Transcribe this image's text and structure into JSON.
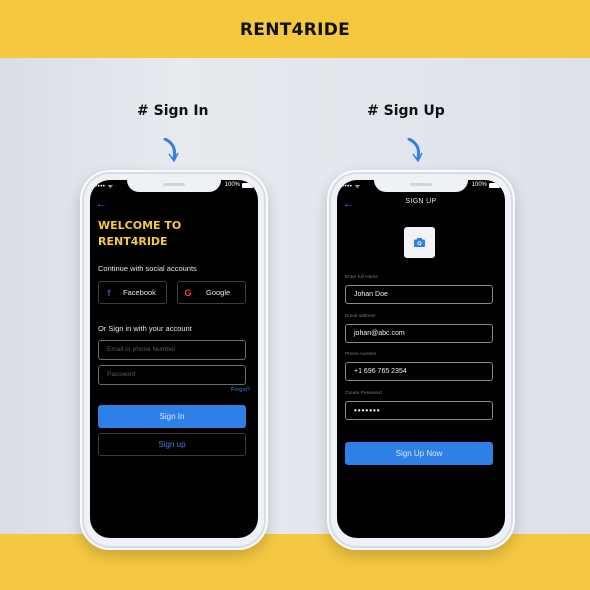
{
  "brand": "RENT4RIDE",
  "colors": {
    "accent_yellow": "#f5c840",
    "primary_blue": "#2e7fe6",
    "screen_bg": "#000000"
  },
  "sections": {
    "signin_title": "# Sign In",
    "signup_title": "# Sign Up"
  },
  "status_bar": {
    "signal": "•••• ᯤ",
    "battery_text": "100%"
  },
  "signin": {
    "back_icon": "←",
    "welcome_line1": "WELCOME TO",
    "welcome_line2": "RENT4RIDE",
    "social_label": "Continue with social accounts",
    "facebook_icon": "f",
    "facebook_label": "Facebook",
    "google_icon": "G",
    "google_label": "Google",
    "account_label": "Or Sign in with your account",
    "email_placeholder": "Email or phone Number",
    "password_placeholder": "Password",
    "forgot_label": "Forgot?",
    "signin_button": "Sign In",
    "signup_button": "Sign up"
  },
  "signup": {
    "back_icon": "←",
    "title": "SIGN UP",
    "fields": [
      {
        "label": "Enter full Name",
        "value": "Johan Doe"
      },
      {
        "label": "Email address",
        "value": "johan@abc.com"
      },
      {
        "label": "Phone number",
        "value": "+1 696 765 2354"
      },
      {
        "label": "Create Password",
        "value": "•••••••"
      }
    ],
    "submit_button": "Sign Up Now"
  }
}
